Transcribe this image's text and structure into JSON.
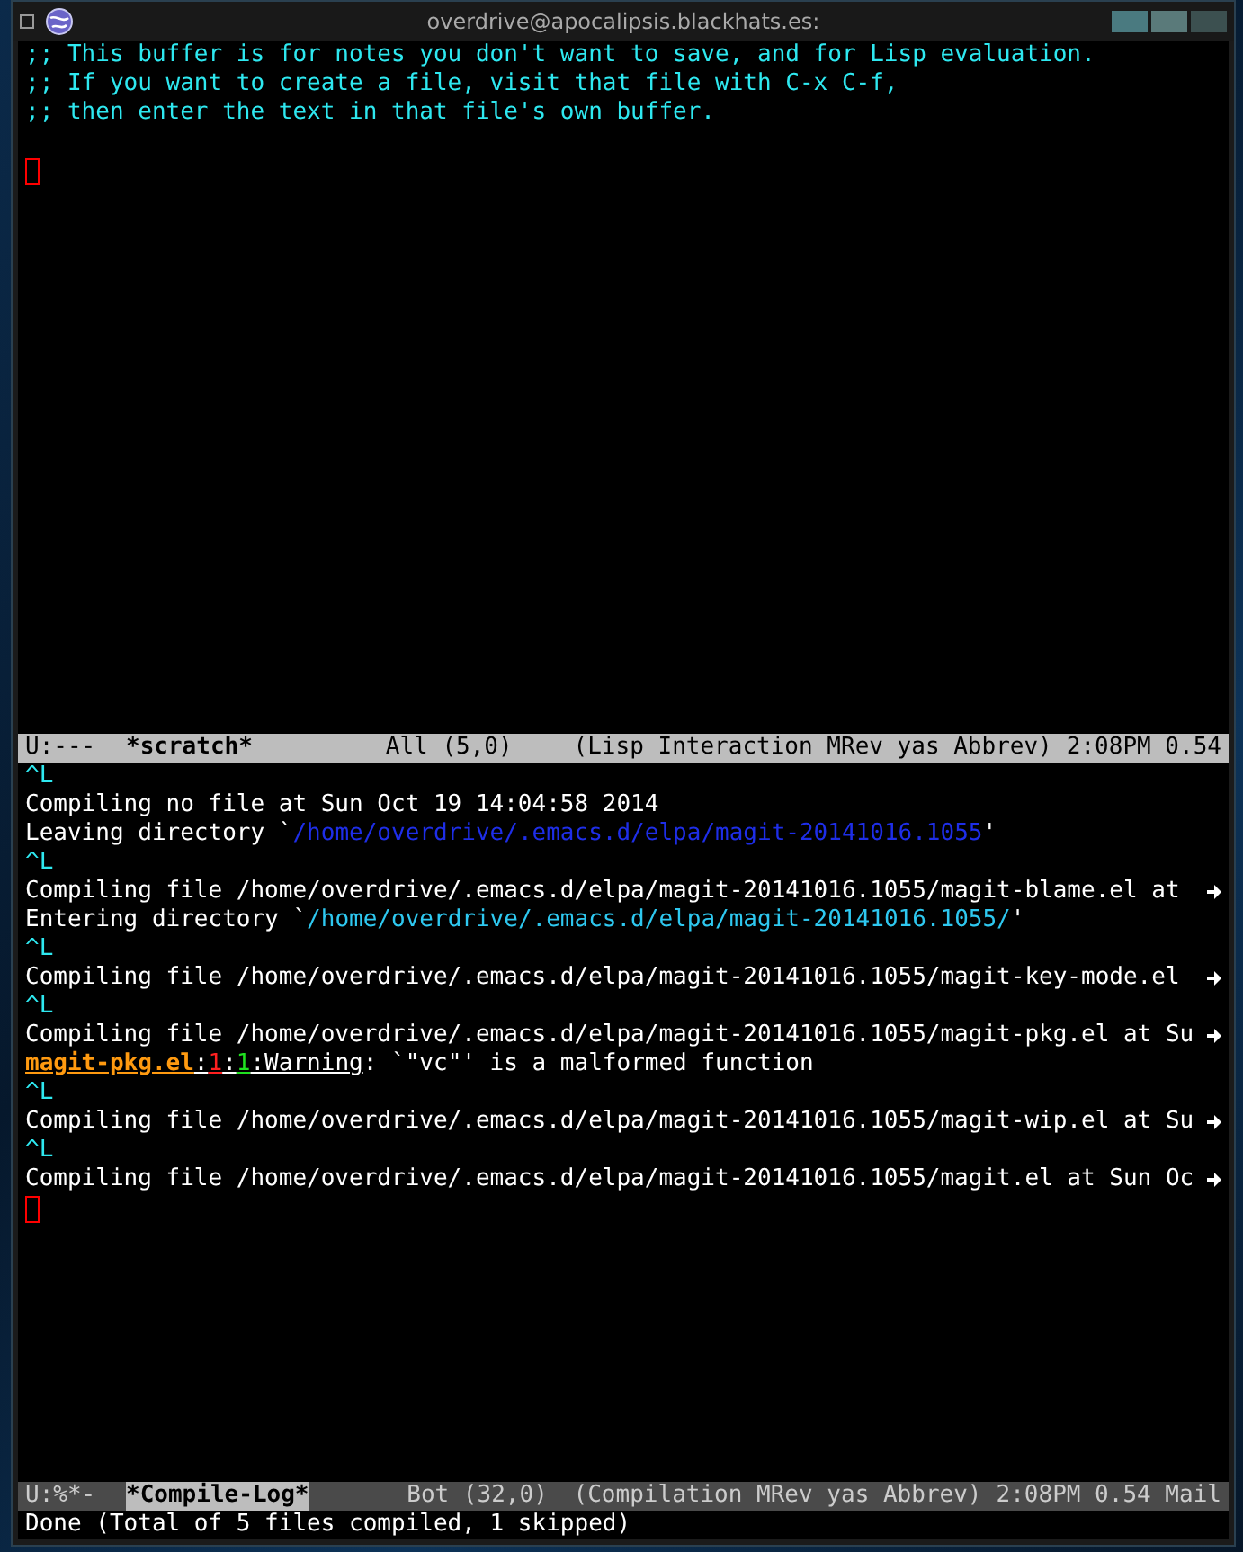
{
  "window": {
    "title": "overdrive@apocalipsis.blackhats.es:"
  },
  "scratch": {
    "lines": [
      {
        "kind": "comment",
        "text": ";; This buffer is for notes you don't want to save, and for Lisp evaluation."
      },
      {
        "kind": "comment",
        "text": ";; If you want to create a file, visit that file with C-x C-f,"
      },
      {
        "kind": "comment",
        "text": ";; then enter the text in that file's own buffer."
      },
      {
        "kind": "blank"
      },
      {
        "kind": "cursor"
      }
    ],
    "mode_line": {
      "active": true,
      "state": "U:---",
      "buffer": "*scratch*",
      "position": "All (5,0)",
      "modes": "(Lisp Interaction MRev yas Abbrev)",
      "misc": "2:08PM 0.54"
    }
  },
  "compile_log": {
    "lines": [
      {
        "kind": "formfeed",
        "segments": [
          {
            "kind": "formfeed",
            "text": "^L"
          }
        ]
      },
      {
        "kind": "text",
        "segments": [
          {
            "kind": "plain",
            "text": "Compiling no file at Sun Oct 19 14:04:58 2014"
          }
        ]
      },
      {
        "kind": "text",
        "segments": [
          {
            "kind": "plain",
            "text": "Leaving directory `"
          },
          {
            "kind": "dir-leave",
            "text": "/home/overdrive/.emacs.d/elpa/magit-20141016.1055"
          },
          {
            "kind": "plain",
            "text": "'"
          }
        ]
      },
      {
        "kind": "formfeed",
        "segments": [
          {
            "kind": "formfeed",
            "text": "^L"
          }
        ]
      },
      {
        "kind": "text",
        "truncated": true,
        "segments": [
          {
            "kind": "plain",
            "text": "Compiling file /home/overdrive/.emacs.d/elpa/magit-20141016.1055/magit-blame.el at "
          }
        ]
      },
      {
        "kind": "text",
        "segments": [
          {
            "kind": "plain",
            "text": "Entering directory `"
          },
          {
            "kind": "dir-enter",
            "text": "/home/overdrive/.emacs.d/elpa/magit-20141016.1055/"
          },
          {
            "kind": "plain",
            "text": "'"
          }
        ]
      },
      {
        "kind": "formfeed",
        "segments": [
          {
            "kind": "formfeed",
            "text": "^L"
          }
        ]
      },
      {
        "kind": "text",
        "truncated": true,
        "segments": [
          {
            "kind": "plain",
            "text": "Compiling file /home/overdrive/.emacs.d/elpa/magit-20141016.1055/magit-key-mode.el "
          }
        ]
      },
      {
        "kind": "formfeed",
        "segments": [
          {
            "kind": "formfeed",
            "text": "^L"
          }
        ]
      },
      {
        "kind": "text",
        "truncated": true,
        "segments": [
          {
            "kind": "plain",
            "text": "Compiling file /home/overdrive/.emacs.d/elpa/magit-20141016.1055/magit-pkg.el at Su"
          }
        ]
      },
      {
        "kind": "text",
        "segments": [
          {
            "kind": "file",
            "text": "magit-pkg.el"
          },
          {
            "kind": "sep",
            "text": ":"
          },
          {
            "kind": "line-num",
            "text": "1"
          },
          {
            "kind": "sep",
            "text": ":"
          },
          {
            "kind": "col-num",
            "text": "1"
          },
          {
            "kind": "sep",
            "text": ":Warning"
          },
          {
            "kind": "plain",
            "text": ": `\"vc\"' is a malformed function"
          }
        ]
      },
      {
        "kind": "formfeed",
        "segments": [
          {
            "kind": "formfeed",
            "text": "^L"
          }
        ]
      },
      {
        "kind": "text",
        "truncated": true,
        "segments": [
          {
            "kind": "plain",
            "text": "Compiling file /home/overdrive/.emacs.d/elpa/magit-20141016.1055/magit-wip.el at Su"
          }
        ]
      },
      {
        "kind": "formfeed",
        "segments": [
          {
            "kind": "formfeed",
            "text": "^L"
          }
        ]
      },
      {
        "kind": "text",
        "truncated": true,
        "segments": [
          {
            "kind": "plain",
            "text": "Compiling file /home/overdrive/.emacs.d/elpa/magit-20141016.1055/magit.el at Sun Oc"
          }
        ]
      },
      {
        "kind": "cursor"
      }
    ],
    "mode_line": {
      "active": false,
      "state": "U:%*-",
      "buffer": "*Compile-Log*",
      "position": "Bot (32,0)",
      "modes": "(Compilation MRev yas Abbrev)",
      "misc": "2:08PM 0.54 Mail"
    }
  },
  "echo_area": {
    "text": "Done (Total of 5 files compiled, 1 skipped)"
  }
}
